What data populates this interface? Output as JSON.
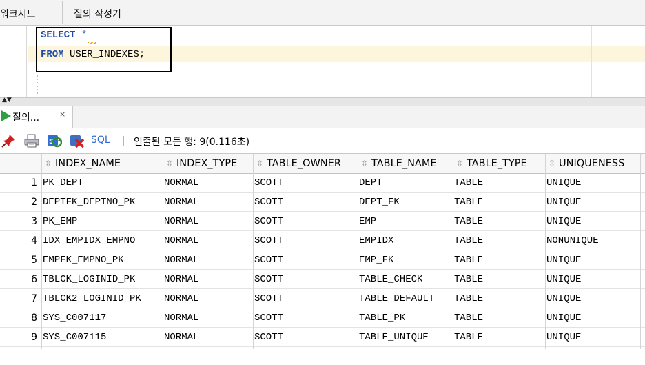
{
  "tabs": {
    "worksheet": "워크시트",
    "query_builder": "질의 작성기"
  },
  "editor": {
    "line1_keyword": "SELECT",
    "line1_rest": " *",
    "line2_keyword": "FROM",
    "line2_rest": " USER_INDEXES;"
  },
  "results_tab": {
    "label": "질의...",
    "close": "×"
  },
  "toolbar": {
    "sql_label": "SQL",
    "separator": "|",
    "status": "인출된 모든 행: 9(0.116초)"
  },
  "columns": [
    "INDEX_NAME",
    "INDEX_TYPE",
    "TABLE_OWNER",
    "TABLE_NAME",
    "TABLE_TYPE",
    "UNIQUENESS"
  ],
  "rows": [
    {
      "n": "1",
      "index_name": "PK_DEPT",
      "index_type": "NORMAL",
      "table_owner": "SCOTT",
      "table_name": "DEPT",
      "table_type": "TABLE",
      "uniqueness": "UNIQUE"
    },
    {
      "n": "2",
      "index_name": "DEPTFK_DEPTNO_PK",
      "index_type": "NORMAL",
      "table_owner": "SCOTT",
      "table_name": "DEPT_FK",
      "table_type": "TABLE",
      "uniqueness": "UNIQUE"
    },
    {
      "n": "3",
      "index_name": "PK_EMP",
      "index_type": "NORMAL",
      "table_owner": "SCOTT",
      "table_name": "EMP",
      "table_type": "TABLE",
      "uniqueness": "UNIQUE"
    },
    {
      "n": "4",
      "index_name": "IDX_EMPIDX_EMPNO",
      "index_type": "NORMAL",
      "table_owner": "SCOTT",
      "table_name": "EMPIDX",
      "table_type": "TABLE",
      "uniqueness": "NONUNIQUE"
    },
    {
      "n": "5",
      "index_name": "EMPFK_EMPNO_PK",
      "index_type": "NORMAL",
      "table_owner": "SCOTT",
      "table_name": "EMP_FK",
      "table_type": "TABLE",
      "uniqueness": "UNIQUE"
    },
    {
      "n": "6",
      "index_name": "TBLCK_LOGINID_PK",
      "index_type": "NORMAL",
      "table_owner": "SCOTT",
      "table_name": "TABLE_CHECK",
      "table_type": "TABLE",
      "uniqueness": "UNIQUE"
    },
    {
      "n": "7",
      "index_name": "TBLCK2_LOGINID_PK",
      "index_type": "NORMAL",
      "table_owner": "SCOTT",
      "table_name": "TABLE_DEFAULT",
      "table_type": "TABLE",
      "uniqueness": "UNIQUE"
    },
    {
      "n": "8",
      "index_name": "SYS_C007117",
      "index_type": "NORMAL",
      "table_owner": "SCOTT",
      "table_name": "TABLE_PK",
      "table_type": "TABLE",
      "uniqueness": "UNIQUE"
    },
    {
      "n": "9",
      "index_name": "SYS_C007115",
      "index_type": "NORMAL",
      "table_owner": "SCOTT",
      "table_name": "TABLE_UNIQUE",
      "table_type": "TABLE",
      "uniqueness": "UNIQUE"
    }
  ]
}
